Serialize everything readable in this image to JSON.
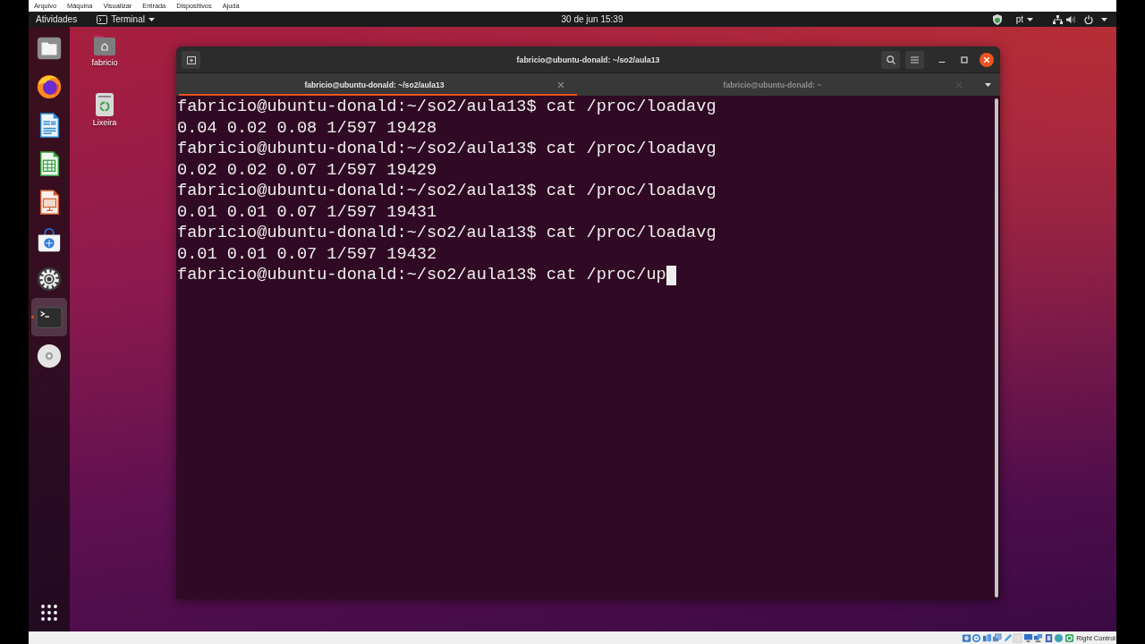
{
  "vm_menu": [
    "Arquivo",
    "Máquina",
    "Visualizar",
    "Entrada",
    "Dispositivos",
    "Ajuda"
  ],
  "top_panel": {
    "activities": "Atividades",
    "app_menu": "Terminal",
    "clock": "30 de jun 15:39",
    "keyboard_layout": "pt"
  },
  "dock": {
    "items": [
      {
        "kind": "files",
        "active": false
      },
      {
        "kind": "browser",
        "active": false
      },
      {
        "kind": "writer",
        "active": false
      },
      {
        "kind": "spreadsheet",
        "active": false
      },
      {
        "kind": "slides",
        "active": false
      },
      {
        "kind": "store",
        "active": false
      },
      {
        "kind": "settings",
        "active": false
      },
      {
        "kind": "terminal",
        "active": true
      },
      {
        "kind": "disc",
        "active": false
      }
    ]
  },
  "desktop": {
    "icons": [
      {
        "kind": "home",
        "label": "fabricio"
      },
      {
        "kind": "trash",
        "label": "Lixeira"
      }
    ]
  },
  "terminal": {
    "title": "fabricio@ubuntu-donald: ~/so2/aula13",
    "tabs": [
      {
        "label": "fabricio@ubuntu-donald: ~/so2/aula13",
        "selected": true
      },
      {
        "label": "fabricio@ubuntu-donald: ~",
        "selected": false
      }
    ],
    "lines": [
      "fabricio@ubuntu-donald:~/so2/aula13$ cat /proc/loadavg",
      "0.04 0.02 0.08 1/597 19428",
      "fabricio@ubuntu-donald:~/so2/aula13$ cat /proc/loadavg",
      "0.02 0.02 0.07 1/597 19429",
      "fabricio@ubuntu-donald:~/so2/aula13$ cat /proc/loadavg",
      "0.01 0.01 0.07 1/597 19431",
      "fabricio@ubuntu-donald:~/so2/aula13$ cat /proc/loadavg",
      "0.01 0.01 0.07 1/597 19432",
      "fabricio@ubuntu-donald:~/so2/aula13$ cat /proc/up"
    ],
    "cursor": true
  },
  "vm_status_bar": {
    "host_key": "Right Control"
  }
}
